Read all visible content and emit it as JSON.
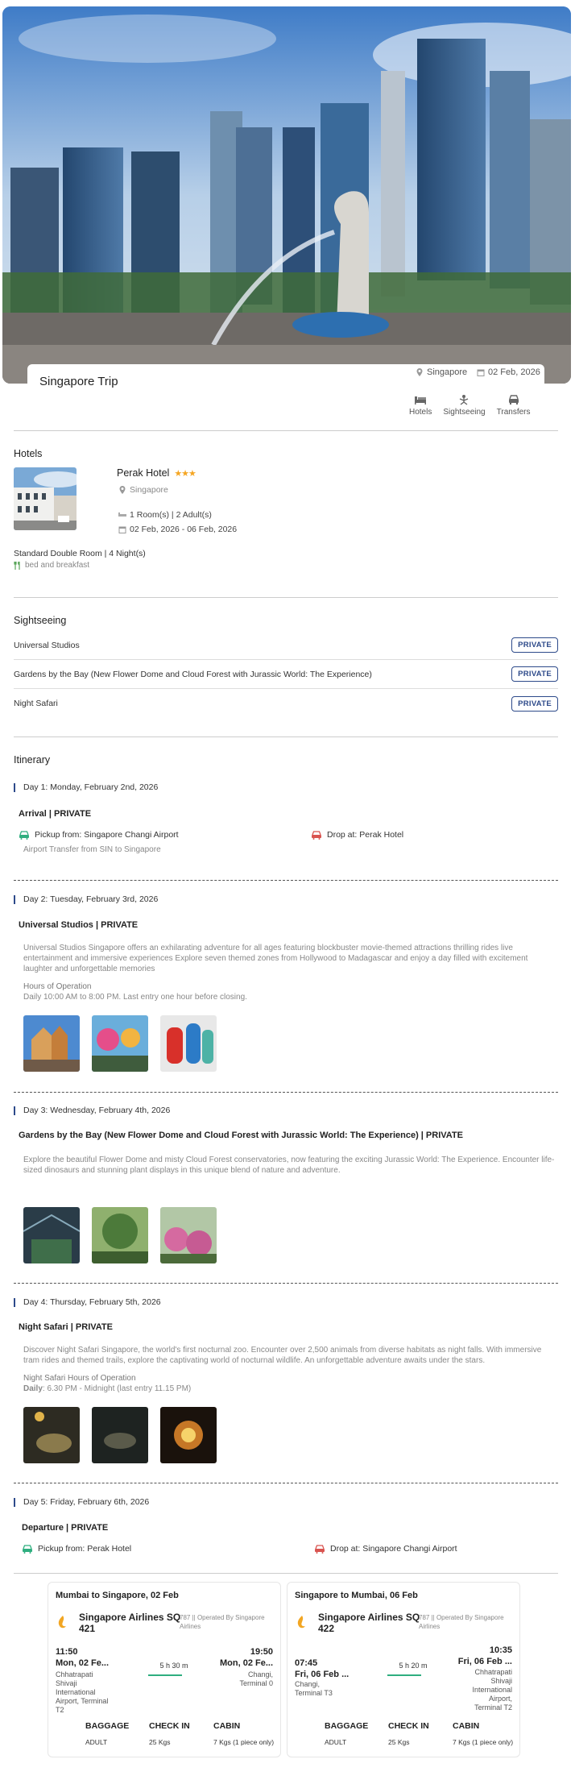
{
  "trip": {
    "title": "Singapore Trip",
    "location": "Singapore",
    "date": "02 Feb, 2026",
    "tabs": [
      "Hotels",
      "Sightseeing",
      "Transfers"
    ]
  },
  "hotels": {
    "heading": "Hotels",
    "name": "Perak Hotel",
    "stars": "★★★",
    "city": "Singapore",
    "rooms": "1 Room(s) | 2 Adult(s)",
    "dates": "02 Feb, 2026 - 06 Feb, 2026",
    "room_type": "Standard Double Room | 4 Night(s)",
    "meal": "bed and breakfast"
  },
  "sightseeing": {
    "heading": "Sightseeing",
    "items": [
      {
        "name": "Universal Studios",
        "badge": "PRIVATE"
      },
      {
        "name": "Gardens by the Bay (New Flower Dome and Cloud Forest with Jurassic World: The Experience)",
        "badge": "PRIVATE"
      },
      {
        "name": "Night Safari",
        "badge": "PRIVATE"
      }
    ]
  },
  "itinerary": {
    "heading": "Itinerary",
    "days": [
      {
        "label": "Day 1: Monday, February 2nd, 2026",
        "title": "Arrival | PRIVATE",
        "pickup": "Pickup from: Singapore Changi Airport",
        "drop": "Drop at: Perak Hotel",
        "note": "Airport Transfer from SIN to Singapore"
      },
      {
        "label": "Day 2: Tuesday, February 3rd, 2026",
        "title": "Universal Studios | PRIVATE",
        "desc": "Universal Studios Singapore offers an exhilarating adventure for all ages featuring blockbuster movie-themed attractions thrilling rides live entertainment and immersive experiences Explore seven themed zones from Hollywood to Madagascar and enjoy a day filled with excitement laughter and unforgettable memories",
        "hours_label": "Hours of Operation",
        "hours": "Daily 10:00 AM to 8:00 PM. Last entry one hour before closing."
      },
      {
        "label": "Day 3: Wednesday, February 4th, 2026",
        "title": "Gardens by the Bay (New Flower Dome and Cloud Forest with Jurassic World: The Experience) | PRIVATE",
        "desc": "Explore the beautiful Flower Dome and misty Cloud Forest conservatories, now featuring the exciting Jurassic World: The Experience. Encounter life-sized dinosaurs and stunning plant displays in this unique blend of nature and adventure."
      },
      {
        "label": "Day 4: Thursday, February 5th, 2026",
        "title": "Night Safari | PRIVATE",
        "desc": "Discover Night Safari Singapore, the world's first nocturnal zoo. Encounter over 2,500 animals from diverse habitats as night falls. With immersive tram rides and themed trails, explore the captivating world of nocturnal wildlife. An unforgettable adventure awaits under the stars.",
        "hours_label": "Night Safari Hours of Operation",
        "hours_bold": "Daily",
        "hours": ": 6.30 PM - Midnight (last entry 11.15 PM)"
      },
      {
        "label": "Day 5: Friday, February 6th, 2026",
        "title": "Departure | PRIVATE",
        "pickup": "Pickup from: Perak Hotel",
        "drop": "Drop at: Singapore Changi Airport"
      }
    ]
  },
  "flights": [
    {
      "route": "Mumbai to Singapore, 02 Feb",
      "airline": "Singapore Airlines SQ 421",
      "operated": "787 || Operated By Singapore Airlines",
      "dep_time": "11:50",
      "dep_date": "Mon, 02 Fe...",
      "dep_airport": "Chhatrapati Shivaji International Airport, Terminal T2",
      "duration": "5 h 30 m",
      "arr_time": "19:50",
      "arr_date": "Mon, 02 Fe...",
      "arr_airport": "Changi, Terminal 0",
      "baggage_h": "BAGGAGE",
      "checkin_h": "CHECK IN",
      "cabin_h": "CABIN",
      "baggage": "ADULT",
      "checkin": "25 Kgs",
      "cabin": "7 Kgs (1 piece only)"
    },
    {
      "route": "Singapore to Mumbai, 06 Feb",
      "airline": "Singapore Airlines SQ 422",
      "operated": "787 || Operated By Singapore Airlines",
      "dep_time": "07:45",
      "dep_date": "Fri, 06 Feb ...",
      "dep_airport": "Changi, Terminal T3",
      "duration": "5 h 20 m",
      "arr_time": "10:35",
      "arr_date": "Fri, 06 Feb ...",
      "arr_airport": "Chhatrapati Shivaji International Airport, Terminal T2",
      "baggage_h": "BAGGAGE",
      "checkin_h": "CHECK IN",
      "cabin_h": "CABIN",
      "baggage": "ADULT",
      "checkin": "25 Kgs",
      "cabin": "7 Kgs (1 piece only)"
    }
  ],
  "colors": {
    "accent": "#2d4a8a",
    "star": "#f5a623",
    "transfer_green": "#2fae7f",
    "drop_red": "#d9534f"
  },
  "icons": [
    "location-pin-icon",
    "calendar-icon",
    "bed-icon",
    "sightseeing-icon",
    "car-icon",
    "meal-icon",
    "airline-logo-icon"
  ]
}
